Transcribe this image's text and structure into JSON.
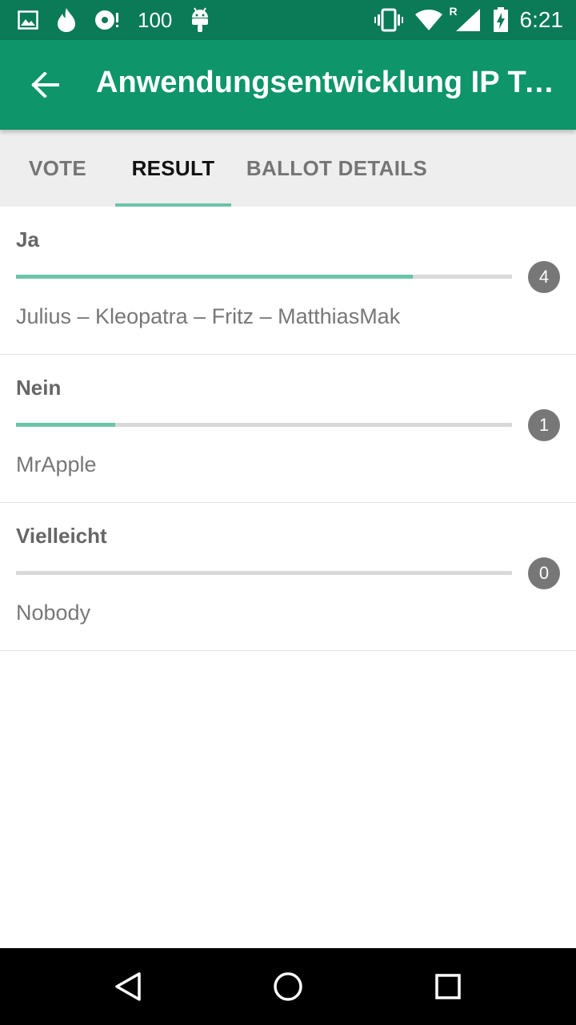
{
  "status_bar": {
    "battery_level_text": "100",
    "network_indicator": "R",
    "time": "6:21",
    "left_icons": [
      "image-icon",
      "flame-icon",
      "disc-icon",
      "android-icon"
    ],
    "right_icons": [
      "vibrate-icon",
      "wifi-icon",
      "signal-icon",
      "battery-charging-icon"
    ]
  },
  "app_bar": {
    "title": "Anwendungsentwicklung IP Tel…",
    "back_icon": "arrow-back-icon"
  },
  "tabs": [
    {
      "label": "VOTE",
      "active": false
    },
    {
      "label": "RESULT",
      "active": true
    },
    {
      "label": "BALLOT DETAILS",
      "active": false
    }
  ],
  "results": [
    {
      "option": "Ja",
      "count": "4",
      "fraction": 0.8,
      "voters": "Julius – Kleopatra – Fritz – MatthiasMak"
    },
    {
      "option": "Nein",
      "count": "1",
      "fraction": 0.2,
      "voters": "MrApple"
    },
    {
      "option": "Vielleicht",
      "count": "0",
      "fraction": 0.0,
      "voters": "Nobody"
    }
  ],
  "nav_bar": {
    "icons": [
      "back-triangle-icon",
      "home-circle-icon",
      "recents-square-icon"
    ]
  },
  "colors": {
    "status_bar": "#0a7a57",
    "app_bar": "#0e9569",
    "accent": "#6cc4a8",
    "badge": "#777777",
    "tab_background": "#eeeeee"
  }
}
